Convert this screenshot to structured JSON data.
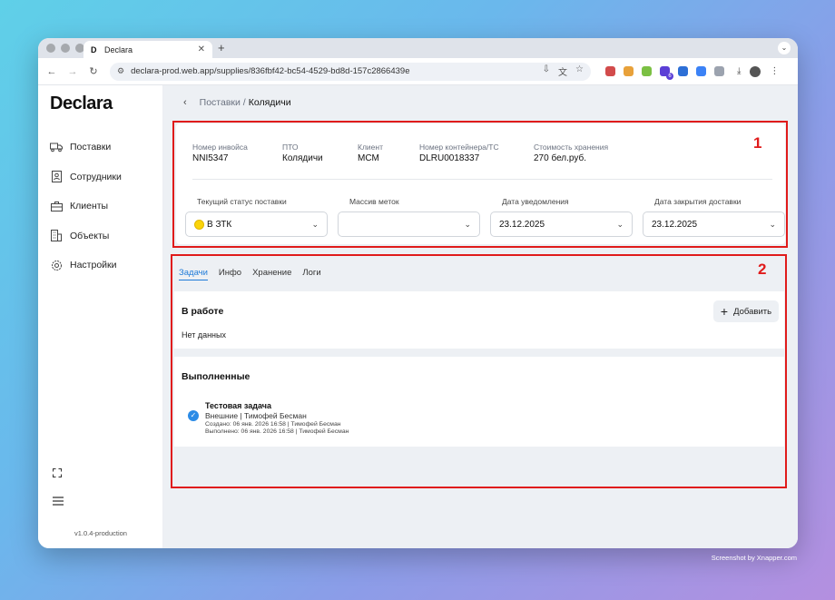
{
  "browser": {
    "tab_title": "Declara",
    "favicon": "D",
    "url": "declara-prod.web.app/supplies/836fbf42-bc54-4529-bd8d-157c2866439e"
  },
  "sidebar": {
    "logo": "Declara",
    "items": [
      {
        "label": "Поставки",
        "icon": "truck-icon"
      },
      {
        "label": "Сотрудники",
        "icon": "badge-icon"
      },
      {
        "label": "Клиенты",
        "icon": "briefcase-icon"
      },
      {
        "label": "Объекты",
        "icon": "building-icon"
      },
      {
        "label": "Настройки",
        "icon": "gear-icon"
      }
    ],
    "version": "v1.0.4-production"
  },
  "breadcrumb": {
    "parent": "Поставки /",
    "current": "Колядичи"
  },
  "info": [
    {
      "label": "Номер инвойса",
      "value": "NNI5347"
    },
    {
      "label": "ПТО",
      "value": "Колядичи"
    },
    {
      "label": "Клиент",
      "value": "МСМ"
    },
    {
      "label": "Номер контейнера/ТС",
      "value": "DLRU0018337"
    },
    {
      "label": "Стоимость хранения",
      "value": "270 бел.руб."
    }
  ],
  "fields": [
    {
      "label": "Текущий статус поставки",
      "value": "В ЗТК",
      "status_color": "#fbd40a"
    },
    {
      "label": "Массив меток",
      "value": ""
    },
    {
      "label": "Дата уведомления",
      "value": "23.12.2025"
    },
    {
      "label": "Дата закрытия доставки",
      "value": "23.12.2025"
    }
  ],
  "annotations": {
    "frame1": "1",
    "frame2": "2",
    "color": "#e01b1b"
  },
  "tabs": [
    {
      "label": "Задачи",
      "active": true
    },
    {
      "label": "Инфо",
      "active": false
    },
    {
      "label": "Хранение",
      "active": false
    },
    {
      "label": "Логи",
      "active": false
    }
  ],
  "in_progress": {
    "title": "В работе",
    "add_label": "Добавить",
    "empty": "Нет данных"
  },
  "completed": {
    "title": "Выполненные",
    "task": {
      "title": "Тестовая задача",
      "subtitle": "Внешние | Тимофей Бесман",
      "created": "Создано: 06 янв. 2026 16:58 | Тимофей Бесман",
      "done": "Выполнено: 06 янв. 2026 16:58 | Тимофей Бесман"
    }
  },
  "watermark": "Screenshot by Xnapper.com",
  "accent": "#1f7bd8"
}
